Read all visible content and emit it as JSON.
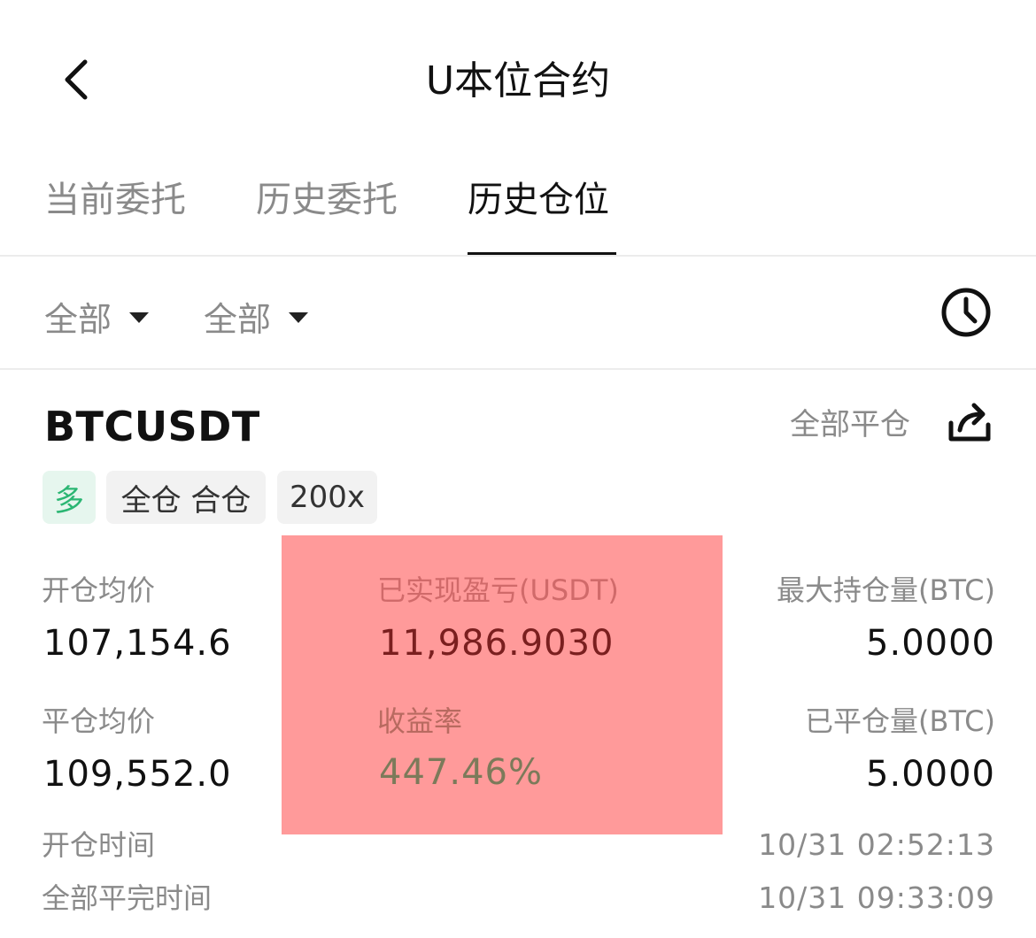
{
  "header": {
    "title": "U本位合约"
  },
  "tabs": [
    {
      "label": "当前委托",
      "active": false
    },
    {
      "label": "历史委托",
      "active": false
    },
    {
      "label": "历史仓位",
      "active": true
    }
  ],
  "filters": {
    "first": "全部",
    "second": "全部"
  },
  "icons": {
    "back": "chevron-left-icon",
    "history": "clock-icon",
    "share": "share-icon",
    "dropdown": "caret-down-icon"
  },
  "position": {
    "symbol": "BTCUSDT",
    "close_all_label": "全部平仓",
    "tags": {
      "direction": "多",
      "margin_mode": "全仓 合仓",
      "leverage": "200x"
    },
    "open_avg_label": "开仓均价",
    "open_avg_value": "107,154.6",
    "realized_pnl_label": "已实现盈亏(USDT)",
    "realized_pnl_value": "11,986.9030",
    "max_hold_label": "最大持仓量(BTC)",
    "max_hold_value": "5.0000",
    "close_avg_label": "平仓均价",
    "close_avg_value": "109,552.0",
    "roi_label": "收益率",
    "roi_value": "447.46%",
    "closed_qty_label": "已平仓量(BTC)",
    "closed_qty_value": "5.0000",
    "open_time_label": "开仓时间",
    "open_time_value": "10/31 02:52:13",
    "close_time_label": "全部平完时间",
    "close_time_value": "10/31 09:33:09"
  },
  "colors": {
    "long_green": "#2bb673",
    "overlay_red": "#ff9a9a",
    "muted_text": "#8a8a8a"
  }
}
